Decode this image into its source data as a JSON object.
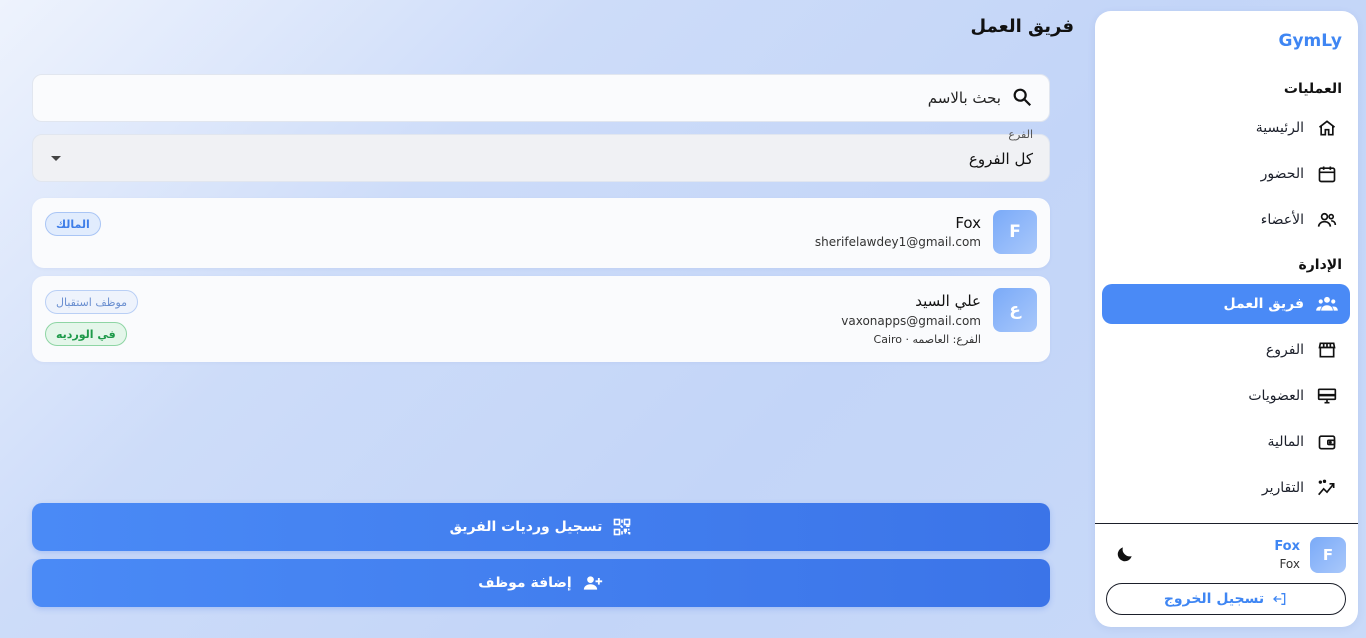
{
  "sidebar": {
    "brand": "GymLy",
    "sections": [
      {
        "title": "العمليات"
      },
      {
        "title": "الإدارة"
      }
    ],
    "items": [
      {
        "label": "الرئيسية",
        "icon": "home-icon"
      },
      {
        "label": "الحضور",
        "icon": "calendar-icon"
      },
      {
        "label": "الأعضاء",
        "icon": "users-icon"
      },
      {
        "label": "فريق العمل",
        "icon": "team-icon",
        "active": true
      },
      {
        "label": "الفروع",
        "icon": "store-icon"
      },
      {
        "label": "العضويات",
        "icon": "card-icon"
      },
      {
        "label": "المالية",
        "icon": "wallet-icon"
      },
      {
        "label": "التقارير",
        "icon": "trend-icon"
      }
    ],
    "user": {
      "avatar": "F",
      "name": "Fox",
      "sub": "Fox"
    },
    "logout_label": "تسجيل الخروج"
  },
  "main": {
    "title": "فريق العمل",
    "search": {
      "placeholder": "بحث بالاسم"
    },
    "branch_filter": {
      "label": "الفرع",
      "value": "كل الفروع"
    },
    "staff": [
      {
        "avatar": "F",
        "name": "Fox",
        "email": "sherifelawdey1@gmail.com",
        "chips": [
          "المالك"
        ]
      },
      {
        "avatar": "ع",
        "name": "علي السيد",
        "email": "vaxonapps@gmail.com",
        "meta": "الفرع: العاصمه · Cairo",
        "chips": [
          "موظف استقبال",
          "في الورديه"
        ]
      }
    ],
    "buttons": {
      "shifts": "تسجيل ورديات الفريق",
      "add": "إضافة موظف"
    }
  },
  "colors": {
    "accent": "#4a8af6",
    "brand": "#3f86f3",
    "success": "#1e9a4a"
  }
}
